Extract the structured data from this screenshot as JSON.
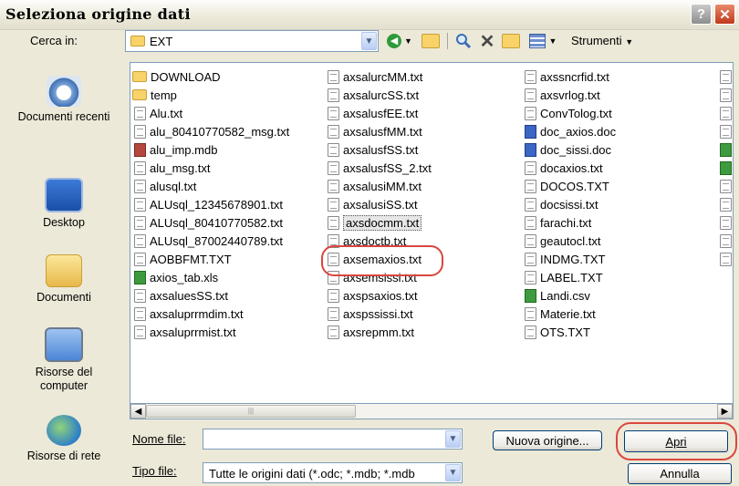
{
  "window": {
    "title": "Seleziona origine dati"
  },
  "look_in": {
    "label": "Cerca in:",
    "value": "EXT",
    "tools_label": "Strumenti"
  },
  "places": [
    {
      "label": "Documenti recenti",
      "icon": "recent-documents-icon"
    },
    {
      "label": "Desktop",
      "icon": "desktop-icon"
    },
    {
      "label": "Documenti",
      "icon": "documents-icon"
    },
    {
      "label": "Risorse del computer",
      "icon": "my-computer-icon"
    },
    {
      "label": "Risorse di rete",
      "icon": "network-icon"
    }
  ],
  "files": {
    "col1": [
      {
        "name": "DOWNLOAD",
        "type": "folder"
      },
      {
        "name": "temp",
        "type": "folder"
      },
      {
        "name": "Alu.txt",
        "type": "txt"
      },
      {
        "name": "alu_80410770582_msg.txt",
        "type": "txt"
      },
      {
        "name": "alu_imp.mdb",
        "type": "mdb"
      },
      {
        "name": "alu_msg.txt",
        "type": "txt"
      },
      {
        "name": "alusql.txt",
        "type": "txt"
      },
      {
        "name": "ALUsql_12345678901.txt",
        "type": "txt"
      },
      {
        "name": "ALUsql_80410770582.txt",
        "type": "txt"
      },
      {
        "name": "ALUsql_87002440789.txt",
        "type": "txt"
      },
      {
        "name": "AOBBFMT.TXT",
        "type": "txt"
      },
      {
        "name": "axios_tab.xls",
        "type": "xls"
      },
      {
        "name": "axsaluesSS.txt",
        "type": "txt"
      },
      {
        "name": "axsaluprrmdim.txt",
        "type": "txt"
      },
      {
        "name": "axsaluprrmist.txt",
        "type": "txt"
      }
    ],
    "col2": [
      {
        "name": "axsalurcMM.txt",
        "type": "txt"
      },
      {
        "name": "axsalurcSS.txt",
        "type": "txt"
      },
      {
        "name": "axsalusfEE.txt",
        "type": "txt"
      },
      {
        "name": "axsalusfMM.txt",
        "type": "txt"
      },
      {
        "name": "axsalusfSS.txt",
        "type": "txt"
      },
      {
        "name": "axsalusfSS_2.txt",
        "type": "txt"
      },
      {
        "name": "axsalusiMM.txt",
        "type": "txt"
      },
      {
        "name": "axsalusiSS.txt",
        "type": "txt"
      },
      {
        "name": "axsdocmm.txt",
        "type": "txt"
      },
      {
        "name": "axsdoctb.txt",
        "type": "txt"
      },
      {
        "name": "axsemaxios.txt",
        "type": "txt"
      },
      {
        "name": "axsemsissi.txt",
        "type": "txt"
      },
      {
        "name": "axspsaxios.txt",
        "type": "txt"
      },
      {
        "name": "axspssissi.txt",
        "type": "txt"
      },
      {
        "name": "axsrepmm.txt",
        "type": "txt"
      }
    ],
    "col3": [
      {
        "name": "axssncrfid.txt",
        "type": "txt"
      },
      {
        "name": "axsvrlog.txt",
        "type": "txt"
      },
      {
        "name": "ConvTolog.txt",
        "type": "txt"
      },
      {
        "name": "doc_axios.doc",
        "type": "doc"
      },
      {
        "name": "doc_sissi.doc",
        "type": "doc"
      },
      {
        "name": "docaxios.txt",
        "type": "txt"
      },
      {
        "name": "DOCOS.TXT",
        "type": "txt"
      },
      {
        "name": "docsissi.txt",
        "type": "txt"
      },
      {
        "name": "farachi.txt",
        "type": "txt"
      },
      {
        "name": "geautocl.txt",
        "type": "txt"
      },
      {
        "name": "INDMG.TXT",
        "type": "txt"
      },
      {
        "name": "LABEL.TXT",
        "type": "txt"
      },
      {
        "name": "Landi.csv",
        "type": "csv"
      },
      {
        "name": "Materie.txt",
        "type": "txt"
      },
      {
        "name": "OTS.TXT",
        "type": "txt"
      }
    ],
    "col4": [
      "txt",
      "txt",
      "txt",
      "txt",
      "xls",
      "xls",
      "txt",
      "txt",
      "txt",
      "txt",
      "txt"
    ],
    "selected": "axsdocmm.txt"
  },
  "filename": {
    "label": "Nome file:",
    "value": ""
  },
  "filetype": {
    "label": "Tipo file:",
    "value": "Tutte le origini dati (*.odc; *.mdb; *.mdb"
  },
  "buttons": {
    "new_source": "Nuova origine...",
    "open": "Apri",
    "cancel": "Annulla"
  },
  "colors": {
    "highlight": "#D9473F",
    "accent": "#003C74"
  }
}
